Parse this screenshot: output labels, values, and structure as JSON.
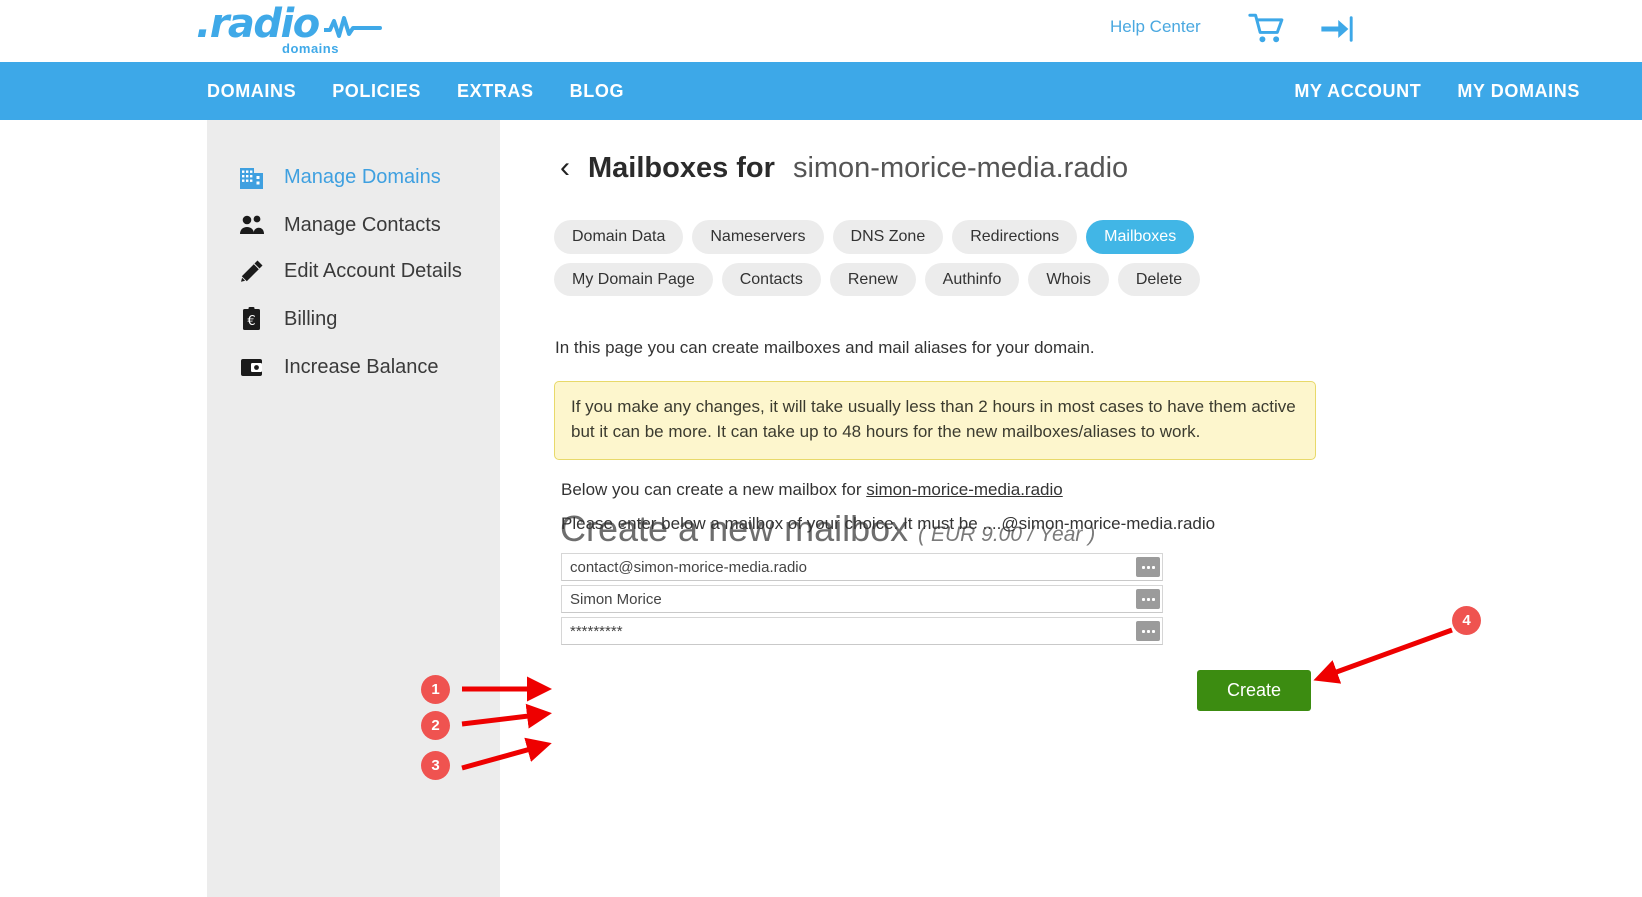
{
  "header": {
    "logo_word": ".radio",
    "logo_sub": "domains",
    "help_link": "Help Center",
    "cart_icon": "cart-icon",
    "login_icon": "login-arrow-icon"
  },
  "nav": {
    "left": [
      "DOMAINS",
      "POLICIES",
      "EXTRAS",
      "BLOG"
    ],
    "right": [
      "MY ACCOUNT",
      "MY DOMAINS"
    ]
  },
  "sidebar": {
    "items": [
      {
        "label": "Manage Domains",
        "icon": "building-icon",
        "active": true
      },
      {
        "label": "Manage Contacts",
        "icon": "people-icon",
        "active": false
      },
      {
        "label": "Edit Account Details",
        "icon": "pencil-icon",
        "active": false
      },
      {
        "label": "Billing",
        "icon": "euro-clipboard-icon",
        "active": false
      },
      {
        "label": "Increase Balance",
        "icon": "wallet-icon",
        "active": false
      }
    ]
  },
  "main": {
    "back_chevron": "‹",
    "title_prefix": "Mailboxes for",
    "title_domain": "simon-morice-media.radio",
    "tabs": [
      {
        "label": "Domain Data",
        "active": false
      },
      {
        "label": "Nameservers",
        "active": false
      },
      {
        "label": "DNS Zone",
        "active": false
      },
      {
        "label": "Redirections",
        "active": false
      },
      {
        "label": "Mailboxes",
        "active": true
      },
      {
        "label": "My Domain Page",
        "active": false
      },
      {
        "label": "Contacts",
        "active": false
      },
      {
        "label": "Renew",
        "active": false
      },
      {
        "label": "Authinfo",
        "active": false
      },
      {
        "label": "Whois",
        "active": false
      },
      {
        "label": "Delete",
        "active": false
      }
    ],
    "intro": "In this page you can create mailboxes and mail aliases for your domain.",
    "notice": "If you make any changes, it will take usually less than 2 hours in most cases to have them active but it can be more. It can take up to 48 hours for the new mailboxes/aliases to work.",
    "create_heading": "Create a new mailbox",
    "create_price": "( EUR 9.00 / Year )",
    "sub_line_1_prefix": "Below you can create a new mailbox for ",
    "sub_line_1_domain": "simon-morice-media.radio",
    "sub_line_2": "Please enter below a mailbox of your choice. It must be ....@simon-morice-media.radio",
    "form": {
      "mailbox_value": "contact@simon-morice-media.radio",
      "mailbox_placeholder": "",
      "name_value": "Simon Morice",
      "name_placeholder": "",
      "password_value": "*********",
      "password_placeholder": "",
      "autofill_icon": "autofill-dots-icon"
    },
    "create_button": "Create"
  },
  "annotations": {
    "markers": [
      {
        "label": "1",
        "target": "mailbox-input"
      },
      {
        "label": "2",
        "target": "name-input"
      },
      {
        "label": "3",
        "target": "password-input"
      },
      {
        "label": "4",
        "target": "create-button"
      }
    ],
    "color": "#ef5350",
    "arrow_color": "#ee0000"
  }
}
